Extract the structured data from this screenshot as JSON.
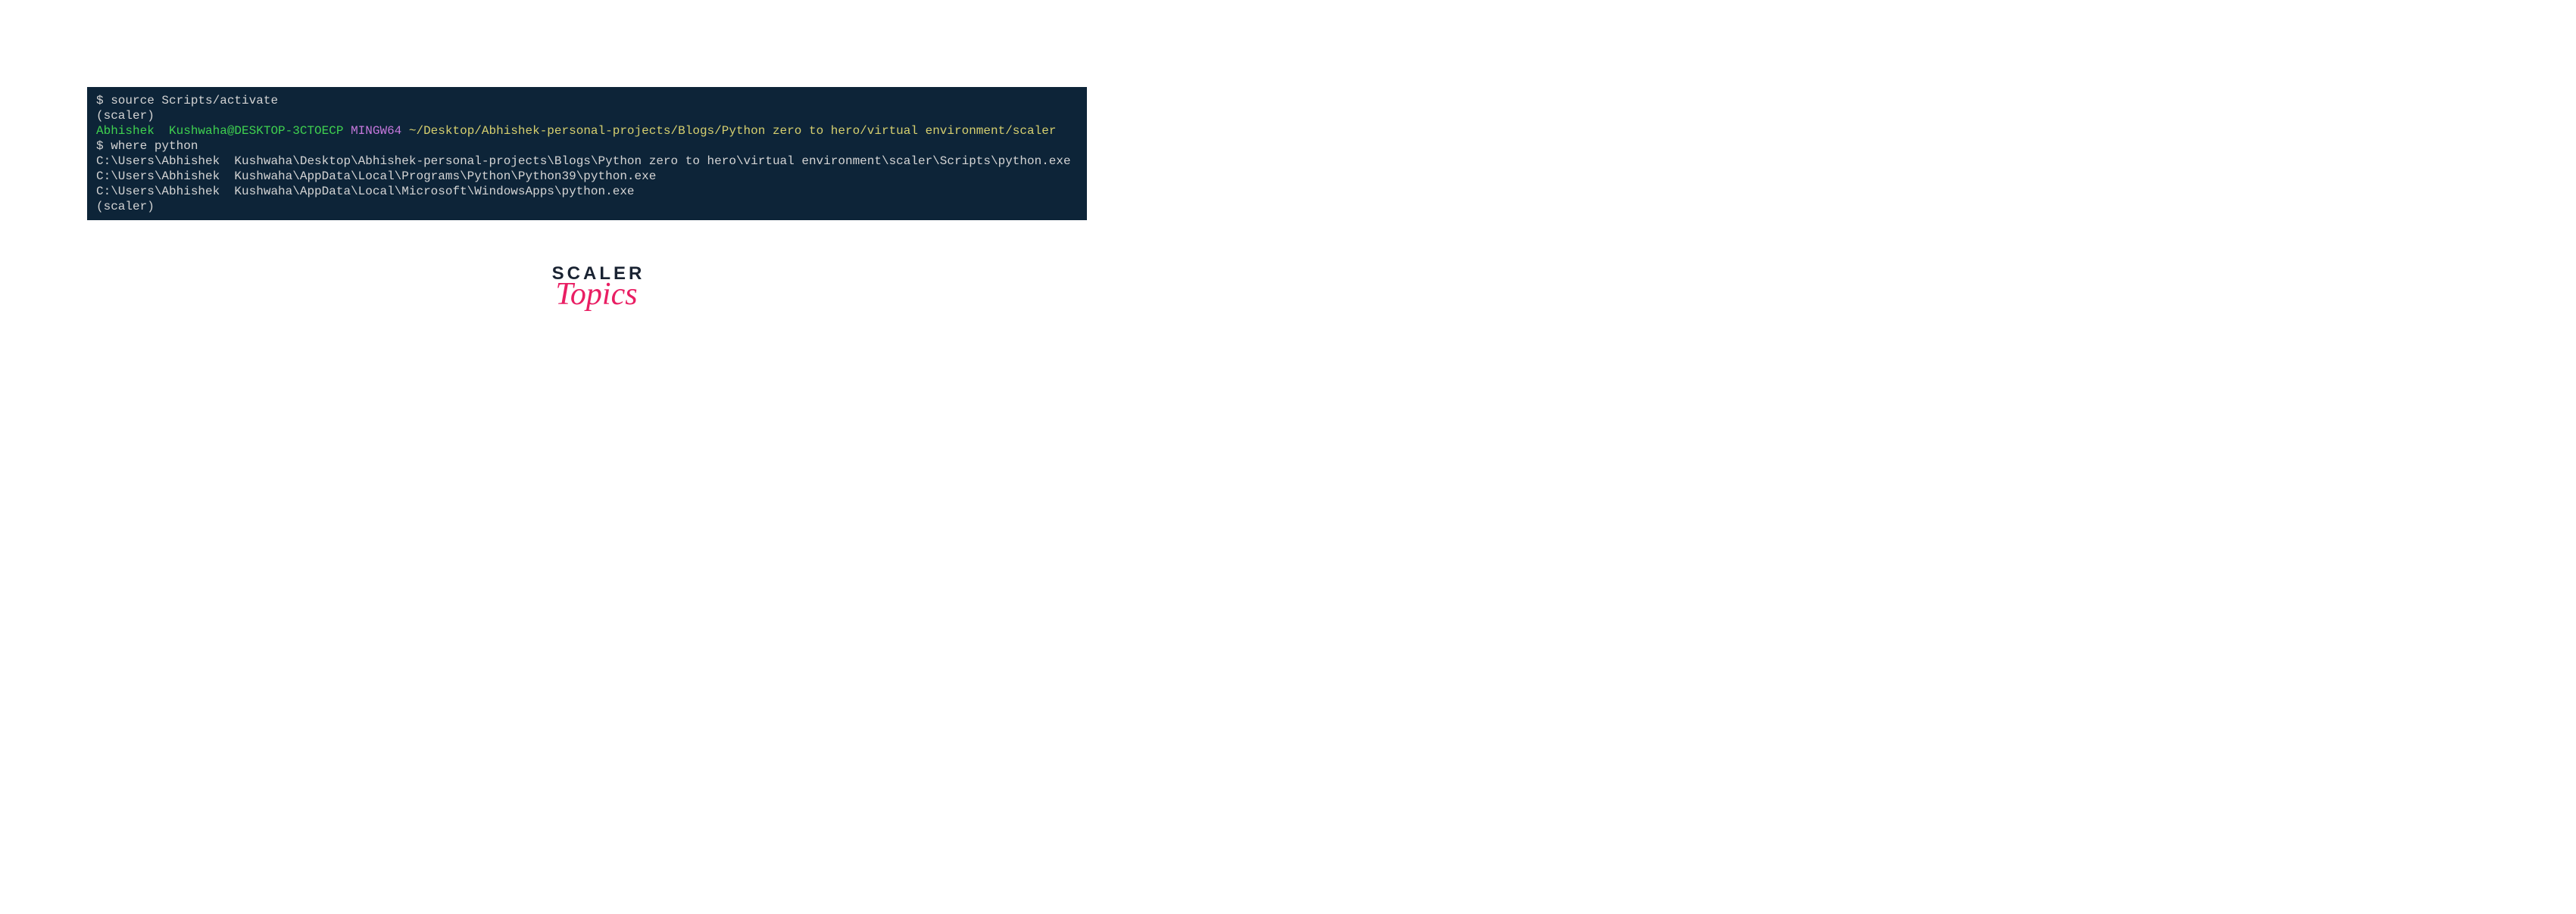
{
  "terminal": {
    "line1": {
      "prompt": "$ ",
      "command": "source Scripts/activate"
    },
    "line2": {
      "venv": "(scaler)"
    },
    "line3": {
      "user_host": "Abhishek  Kushwaha@DESKTOP-3CTOECP ",
      "mingw": "MINGW64 ",
      "path": "~/Desktop/Abhishek-personal-projects/Blogs/Python zero to hero/virtual environment/scaler"
    },
    "line4": {
      "prompt": "$ ",
      "command": "where python"
    },
    "line5": {
      "output": "C:\\Users\\Abhishek  Kushwaha\\Desktop\\Abhishek-personal-projects\\Blogs\\Python zero to hero\\virtual environment\\scaler\\Scripts\\python.exe"
    },
    "line6": {
      "output": "C:\\Users\\Abhishek  Kushwaha\\AppData\\Local\\Programs\\Python\\Python39\\python.exe"
    },
    "line7": {
      "output": "C:\\Users\\Abhishek  Kushwaha\\AppData\\Local\\Microsoft\\WindowsApps\\python.exe"
    },
    "line8": {
      "venv": "(scaler)"
    }
  },
  "logo": {
    "scaler": "SCALER",
    "topics": "Topics"
  }
}
